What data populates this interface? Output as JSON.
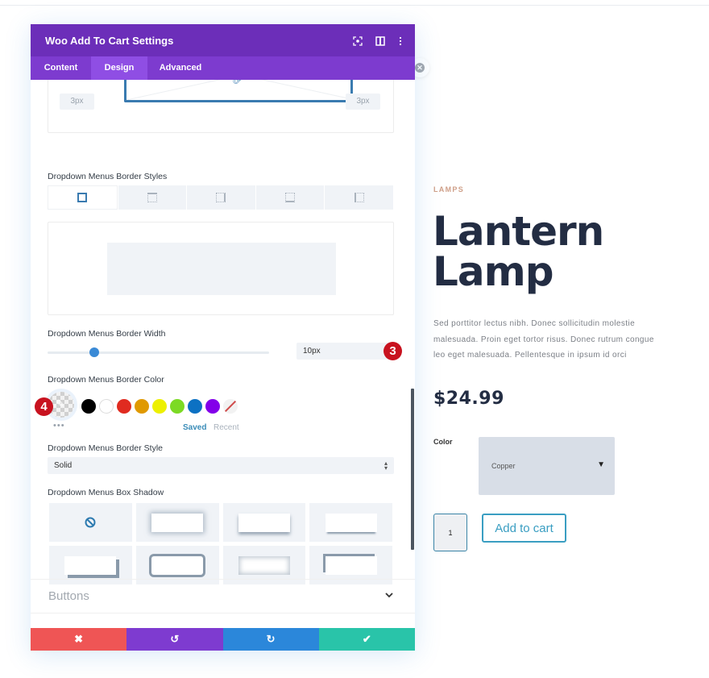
{
  "modal": {
    "title": "Woo Add To Cart Settings",
    "header_icons": [
      "focus-icon",
      "split-view-icon",
      "more-options-icon"
    ],
    "tabs": [
      {
        "label": "Content",
        "active": false
      },
      {
        "label": "Design",
        "active": true
      },
      {
        "label": "Advanced",
        "active": false
      }
    ],
    "border_radius": {
      "left_value": "3px",
      "right_value": "3px",
      "link_icon": "link-icon"
    },
    "border_styles": {
      "label": "Dropdown Menus Border Styles",
      "options": [
        "all",
        "top",
        "right",
        "bottom",
        "left"
      ],
      "selected": "all"
    },
    "border_width": {
      "label": "Dropdown Menus Border Width",
      "value": "10px",
      "slider_fraction": 0.21
    },
    "border_color": {
      "label": "Dropdown Menus Border Color",
      "swatches": [
        "#000000",
        "#ffffff",
        "#e02b20",
        "#e09900",
        "#edf000",
        "#7cda24",
        "#0c71c3",
        "#8300e9",
        "none"
      ],
      "saved_label": "Saved",
      "recent_label": "Recent",
      "more_label": "•••"
    },
    "border_style": {
      "label": "Dropdown Menus Border Style",
      "value": "Solid"
    },
    "box_shadow": {
      "label": "Dropdown Menus Box Shadow",
      "presets": 8,
      "selected": "none"
    },
    "buttons_section": {
      "label": "Buttons",
      "chevron": "⌄"
    },
    "footer": {
      "cancel": {
        "icon": "✖",
        "color": "#ef5555"
      },
      "undo": {
        "icon": "↺",
        "color": "#7e3bd0"
      },
      "redo": {
        "icon": "↻",
        "color": "#2b87da"
      },
      "save": {
        "icon": "✔",
        "color": "#29c4a9"
      }
    },
    "annotations": {
      "step3": "3",
      "step4": "4"
    }
  },
  "product": {
    "category": "LAMPS",
    "title_line1": "Lantern",
    "title_line2": "Lamp",
    "description": "Sed porttitor lectus nibh. Donec sollicitudin molestie malesuada. Proin eget tortor risus. Donec rutrum congue leo eget malesuada. Pellentesque in ipsum id orci",
    "price": "$24.99",
    "color_label": "Color",
    "color_value": "Copper",
    "quantity": "1",
    "add_to_cart": "Add to cart"
  },
  "colors": {
    "header_purple": "#6c2eb9",
    "tab_purple": "#7d3bcf",
    "active_tab": "#8f4ee4",
    "accent_blue": "#2b87da",
    "annotation_red": "#c8121f",
    "title_navy": "#232d43"
  }
}
